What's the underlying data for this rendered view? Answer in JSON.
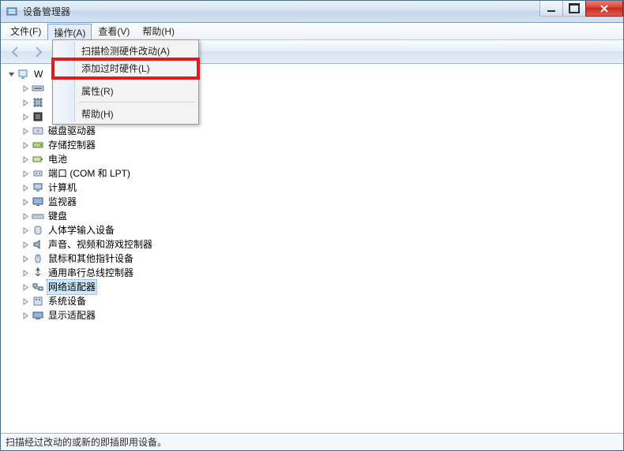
{
  "window": {
    "title": "设备管理器"
  },
  "menu": {
    "items": [
      {
        "label": "文件(F)"
      },
      {
        "label": "操作(A)",
        "open": true
      },
      {
        "label": "查看(V)"
      },
      {
        "label": "帮助(H)"
      }
    ]
  },
  "dropdown": {
    "items": [
      {
        "label": "扫描检测硬件改动(A)"
      },
      {
        "label": "添加过时硬件(L)",
        "highlighted": true
      },
      {
        "sep": true
      },
      {
        "label": "属性(R)"
      },
      {
        "sep": true
      },
      {
        "label": "帮助(H)"
      }
    ]
  },
  "toolbar": {
    "back_enabled": false,
    "fwd_enabled": false
  },
  "tree": {
    "root_label": "W",
    "nodes": [
      {
        "label": "",
        "icon": "ide"
      },
      {
        "label": "",
        "icon": "cpu"
      },
      {
        "label": "",
        "icon": "cpu2"
      },
      {
        "label": "磁盘驱动器",
        "icon": "disk"
      },
      {
        "label": "存储控制器",
        "icon": "storage"
      },
      {
        "label": "电池",
        "icon": "battery"
      },
      {
        "label": "端口 (COM 和 LPT)",
        "icon": "port"
      },
      {
        "label": "计算机",
        "icon": "computer"
      },
      {
        "label": "监视器",
        "icon": "monitor"
      },
      {
        "label": "键盘",
        "icon": "keyboard"
      },
      {
        "label": "人体学输入设备",
        "icon": "hid"
      },
      {
        "label": "声音、视频和游戏控制器",
        "icon": "sound"
      },
      {
        "label": "鼠标和其他指针设备",
        "icon": "mouse"
      },
      {
        "label": "通用串行总线控制器",
        "icon": "usb"
      },
      {
        "label": "网络适配器",
        "icon": "network",
        "selected": true
      },
      {
        "label": "系统设备",
        "icon": "system"
      },
      {
        "label": "显示适配器",
        "icon": "display"
      }
    ]
  },
  "status": {
    "text": "扫描经过改动的或新的即插即用设备。"
  },
  "colors": {
    "highlight_red": "#e11b1b"
  }
}
